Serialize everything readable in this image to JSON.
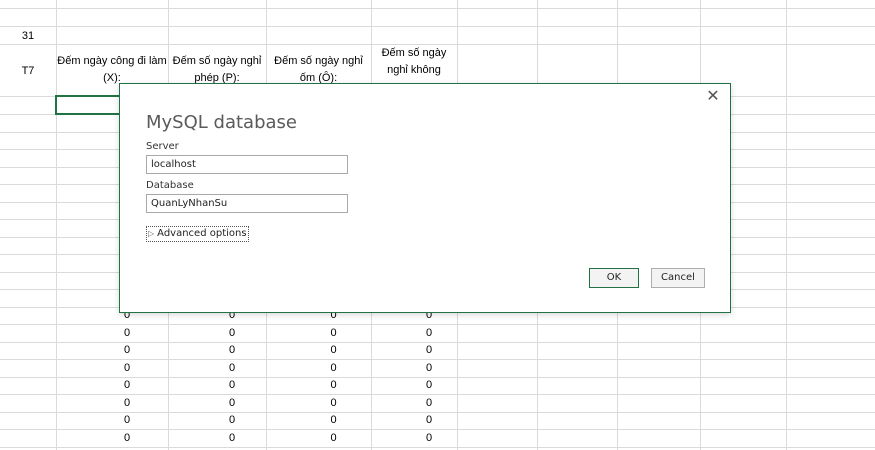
{
  "sheet": {
    "day_number": "31",
    "day_name": "T7",
    "headers": [
      "Đếm ngày công đi làm (X):",
      "Đếm số ngày nghỉ phép (P):",
      "Đếm số ngày nghỉ ốm (Ô):",
      "Đếm số ngày nghỉ không"
    ],
    "cell_value": "0"
  },
  "dialog": {
    "title": "MySQL database",
    "server_label": "Server",
    "server_value": "localhost",
    "database_label": "Database",
    "database_value": "QuanLyNhanSu",
    "advanced_label": "Advanced options",
    "ok_label": "OK",
    "cancel_label": "Cancel",
    "close_icon": "close-icon",
    "expand_icon": "triangle-right-icon"
  },
  "colors": {
    "accent": "#217346",
    "gridline": "#dadada"
  }
}
